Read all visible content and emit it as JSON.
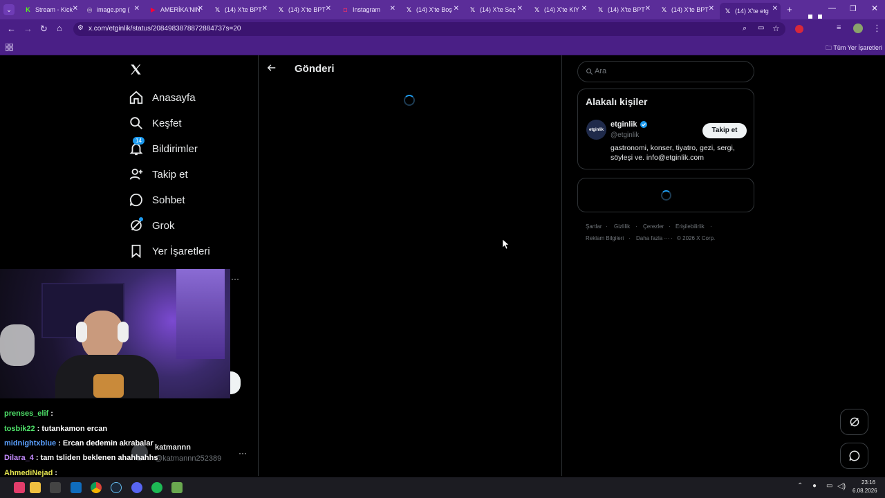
{
  "browser": {
    "tabs": [
      {
        "label": "Stream - Kick",
        "icon": "kick-icon"
      },
      {
        "label": "image.png (",
        "icon": "globe-icon"
      },
      {
        "label": "AMERİKA'NIN",
        "icon": "youtube-icon"
      },
      {
        "label": "(14) X'te BPT",
        "icon": "x-icon"
      },
      {
        "label": "(14) X'te BPT",
        "icon": "x-icon"
      },
      {
        "label": "Instagram",
        "icon": "instagram-icon"
      },
      {
        "label": "(14) X'te Boş",
        "icon": "x-icon"
      },
      {
        "label": "(14) X'te Seç",
        "icon": "x-icon"
      },
      {
        "label": "(14) X'te KIY",
        "icon": "x-icon"
      },
      {
        "label": "(14) X'te BPT",
        "icon": "x-icon"
      },
      {
        "label": "(14) X'te BPT",
        "icon": "x-icon"
      },
      {
        "label": "(14) X'te etg",
        "icon": "x-icon"
      }
    ],
    "url": "x.com/etginlik/status/2084983878872884737s=20",
    "bookmarks_all": "Tüm Yer İşaretleri"
  },
  "nav": {
    "items": [
      {
        "label": "Anasayfa",
        "icon": "home-icon"
      },
      {
        "label": "Keşfet",
        "icon": "search-icon"
      },
      {
        "label": "Bildirimler",
        "icon": "bell-icon",
        "badge": "14"
      },
      {
        "label": "Takip et",
        "icon": "follow-icon"
      },
      {
        "label": "Sohbet",
        "icon": "chat-icon"
      },
      {
        "label": "Grok",
        "icon": "grok-icon"
      },
      {
        "label": "Yer İşaretleri",
        "icon": "bookmark-icon"
      }
    ]
  },
  "main": {
    "title": "Gönderi"
  },
  "right": {
    "search_placeholder": "Ara",
    "related_title": "Alakalı kişiler",
    "person": {
      "name": "etginlik",
      "handle": "@etginlik",
      "avatar_text": "etginlik",
      "bio": "gastronomi, konser, tiyatro, gezi, sergi, söyleşi ve. info@etginlik.com",
      "follow_label": "Takip et"
    },
    "footer": [
      "Şartlar",
      "Gizlilik",
      "Çerezler",
      "Erişilebilirlik",
      "Reklam Bilgileri",
      "Daha fazla ···",
      "© 2026 X Corp."
    ]
  },
  "account": {
    "name": "katmannn",
    "handle": "@katmannn252389"
  },
  "stream_chat": [
    {
      "user": "prenses_elif",
      "text": ":",
      "color": "#4fe36a"
    },
    {
      "user": "tosbik22",
      "text": ": tutankamon ercan",
      "color": "#4fe36a"
    },
    {
      "user": "midnightxblue",
      "text": ": Ercan dedemin akrabalar",
      "color": "#5aa0ff"
    },
    {
      "user": "Dilara_4",
      "text": ": tam tsliden beklenen ahahhahhs",
      "color": "#c58bff"
    },
    {
      "user": "AhmediNejad",
      "text": ":",
      "color": "#e3e34f"
    }
  ],
  "taskbar": {
    "time": "23:16",
    "date": "6.08.2026"
  },
  "colors": {
    "browser_accent": "#5b2d99",
    "x_blue": "#1d9bf0",
    "border": "#2f3336"
  }
}
